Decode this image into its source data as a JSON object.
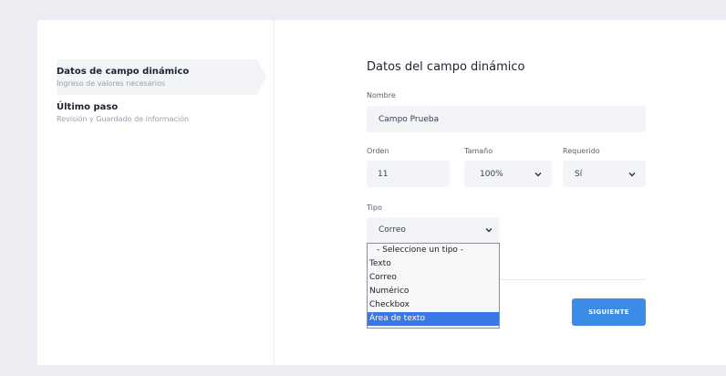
{
  "steps": [
    {
      "title": "Datos de campo dinámico",
      "subtitle": "Ingreso de valores necesarios",
      "active": true
    },
    {
      "title": "Último paso",
      "subtitle": "Revisión y Guardado de información",
      "active": false
    }
  ],
  "form": {
    "title": "Datos del campo dinámico",
    "nombre": {
      "label": "Nombre",
      "value": "Campo Prueba"
    },
    "orden": {
      "label": "Orden",
      "value": "11"
    },
    "tamano": {
      "label": "Tamaño",
      "value": "100%"
    },
    "requerido": {
      "label": "Requerido",
      "value": "Sí"
    },
    "tipo": {
      "label": "Tipo",
      "value": "Correo",
      "options": [
        "- Seleccione un tipo -",
        "Texto",
        "Correo",
        "Numérico",
        "Checkbox",
        "Área de texto"
      ],
      "highlighted_option": "Área de texto"
    },
    "next_button": "SIGUIENTE"
  },
  "colors": {
    "accent": "#3c8ce7",
    "highlight": "#3b78e7",
    "field_bg": "#f3f4f8",
    "page_bg": "#ebedf2"
  }
}
